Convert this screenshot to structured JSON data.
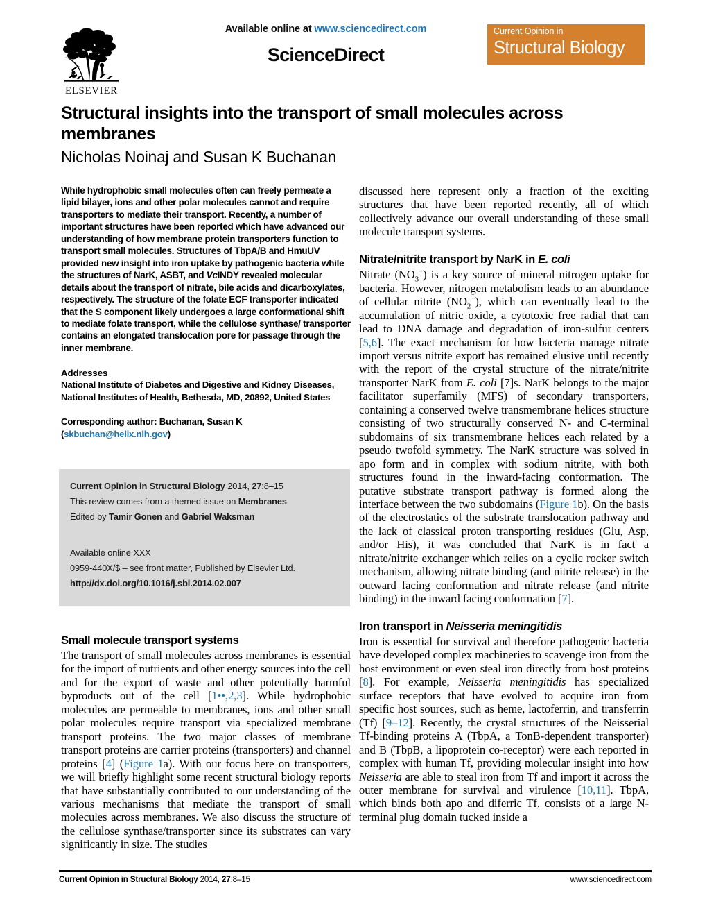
{
  "masthead": {
    "elsevier_label": "ELSEVIER",
    "available_online_prefix": "Available online at ",
    "sciencedirect_url": "www.sciencedirect.com",
    "sciencedirect_wordmark": "ScienceDirect",
    "journal_badge_top": "Current Opinion in",
    "journal_badge_main": "Structural Biology",
    "badge_color": "#d5802c",
    "link_color": "#2077b8"
  },
  "article": {
    "title": "Structural insights into the transport of small molecules across membranes",
    "authors": "Nicholas Noinaj and Susan K Buchanan"
  },
  "abstract": {
    "text": "While hydrophobic small molecules often can freely permeate a lipid bilayer, ions and other polar molecules cannot and require transporters to mediate their transport. Recently, a number of important structures have been reported which have advanced our understanding of how membrane protein transporters function to transport small molecules. Structures of TbpA/B and HmuUV provided new insight into iron uptake by pathogenic bacteria while the structures of NarK, ASBT, and",
    "text_italic": "Vc",
    "text_after_italic": "INDY revealed molecular details about the transport of nitrate, bile acids and dicarboxylates, respectively. The structure of the folate ECF transporter indicated that the S component likely undergoes a large conformational shift to mediate folate transport, while the cellulose synthase/ transporter contains an elongated translocation pore for passage through the inner membrane."
  },
  "addresses": {
    "heading": "Addresses",
    "line1": "National Institute of Diabetes and Digestive and Kidney Diseases,",
    "line2": "National Institutes of Health, Bethesda, MD, 20892, United States",
    "corresponding_prefix": "Corresponding author: Buchanan, Susan K (",
    "corresponding_email": "skbuchan@helix.nih.gov",
    "corresponding_suffix": ")"
  },
  "infobox": {
    "citation_journal": "Current Opinion in Structural Biology",
    "citation_rest": " 2014, ",
    "citation_volume": "27",
    "citation_pages": ":8–15",
    "themed_issue_prefix": "This review comes from a themed issue on ",
    "themed_issue_topic": "Membranes",
    "edited_prefix": "Edited by ",
    "editor_one": "Tamir Gonen",
    "edited_conj": " and ",
    "editor_two": "Gabriel Waksman",
    "available_online": "Available online XXX",
    "front_matter": "0959-440X/$ – see front matter, Published by Elsevier Ltd.",
    "doi": "http://dx.doi.org/10.1016/j.sbi.2014.02.007",
    "bg_color": "#d9d9d9",
    "doi_color": "#1b6ea8"
  },
  "sections": {
    "small_molecule": {
      "heading": "Small molecule transport systems",
      "p1_a": "The transport of small molecules across membranes is essential for the import of nutrients and other energy sources into the cell and for the export of waste and other potentially harmful byproducts out of the cell [",
      "p1_ref1": "1••,2,3",
      "p1_b": "]. While hydrophobic molecules are permeable to membranes, ions and other small polar molecules require transport via specialized membrane transport proteins. The two major classes of membrane transport proteins are carrier proteins (transporters) and channel proteins [",
      "p1_ref2": "4",
      "p1_c": "] (",
      "p1_figref": "Figure 1",
      "p1_d": "a). With our focus here on transporters, we will briefly highlight some recent structural biology reports that have substantially contributed to our understanding of the various mechanisms that mediate the transport of small molecules across membranes. We also discuss the structure of the cellulose synthase/transporter since its substrates can vary significantly in size. The studies"
    },
    "right_continuation": "discussed here represent only a fraction of the exciting structures that have been reported recently, all of which collectively advance our overall understanding of these small molecule transport systems.",
    "nark": {
      "heading_plain": "Nitrate/nitrite transport by NarK in ",
      "heading_italic": "E. coli",
      "p_a": "Nitrate (NO",
      "p_sub1": "3",
      "p_sup1": "−",
      "p_b": ") is a key source of mineral nitrogen uptake for bacteria. However, nitrogen metabolism leads to an abundance of cellular nitrite (NO",
      "p_sub2": "2",
      "p_sup2": "−",
      "p_c": "), which can eventually lead to the accumulation of nitric oxide, a cytotoxic free radial that can lead to DNA damage and degradation of iron-sulfur centers [",
      "p_ref1": "5,6",
      "p_d": "]. The exact mechanism for how bacteria manage nitrate import versus nitrite export has remained elusive until recently with the report of the crystal structure of the nitrate/nitrite transporter NarK from ",
      "p_italic1": "E. coli",
      "p_e": " [7]s. NarK belongs to the major facilitator superfamily (MFS) of secondary transporters, containing a conserved twelve transmembrane helices structure consisting of two structurally conserved N- and C-terminal subdomains of six transmembrane helices each related by a pseudo twofold symmetry. The NarK structure was solved in apo form and in complex with sodium nitrite, with both structures found in the inward-facing conformation. The putative substrate transport pathway is formed along the interface between the two subdomains (",
      "p_figref": "Figure 1",
      "p_f": "b). On the basis of the electrostatics of the substrate translocation pathway and the lack of classical proton transporting residues (Glu, Asp, and/or His), it was concluded that NarK is in fact a nitrate/nitrite exchanger which relies on a cyclic rocker switch mechanism, allowing nitrate binding (and nitrite release) in the outward facing conformation and nitrate release (and nitrite binding) in the inward facing conformation [",
      "p_ref2": "7",
      "p_g": "]."
    },
    "iron": {
      "heading_plain": "Iron transport in ",
      "heading_italic": "Neisseria meningitidis",
      "p_a": "Iron is essential for survival and therefore pathogenic bacteria have developed complex machineries to scavenge iron from the host environment or even steal iron directly from host proteins [",
      "p_ref1": "8",
      "p_b": "]. For example, ",
      "p_italic1": "Neisseria meningitidis",
      "p_c": " has specialized surface receptors that have evolved to acquire iron from specific host sources, such as heme, lactoferrin, and transferrin (Tf) [",
      "p_ref2": "9–12",
      "p_d": "]. Recently, the crystal structures of the Neisserial Tf-binding proteins A (TbpA, a TonB-dependent transporter) and B (TbpB, a lipoprotein co-receptor) were each reported in complex with human Tf, providing molecular insight into how ",
      "p_italic2": "Neisseria",
      "p_e": " are able to steal iron from Tf and import it across the outer membrane for survival and virulence [",
      "p_ref3": "10,11",
      "p_f": "]. TbpA, which binds both apo and diferric Tf, consists of a large N-terminal plug domain tucked inside a"
    }
  },
  "footer": {
    "journal_bold": "Current Opinion in Structural Biology",
    "journal_rest": " 2014, ",
    "volume": "27",
    "pages": ":8–15",
    "website": "www.sciencedirect.com"
  }
}
